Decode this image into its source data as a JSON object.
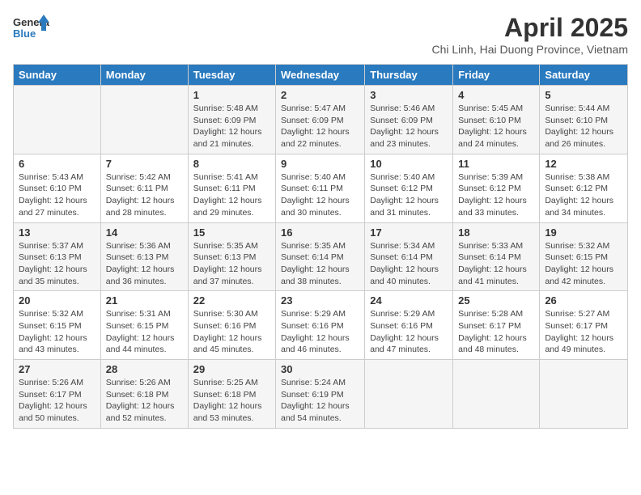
{
  "header": {
    "logo_general": "General",
    "logo_blue": "Blue",
    "title": "April 2025",
    "subtitle": "Chi Linh, Hai Duong Province, Vietnam"
  },
  "weekdays": [
    "Sunday",
    "Monday",
    "Tuesday",
    "Wednesday",
    "Thursday",
    "Friday",
    "Saturday"
  ],
  "weeks": [
    [
      {
        "day": "",
        "info": ""
      },
      {
        "day": "",
        "info": ""
      },
      {
        "day": "1",
        "info": "Sunrise: 5:48 AM\nSunset: 6:09 PM\nDaylight: 12 hours and 21 minutes."
      },
      {
        "day": "2",
        "info": "Sunrise: 5:47 AM\nSunset: 6:09 PM\nDaylight: 12 hours and 22 minutes."
      },
      {
        "day": "3",
        "info": "Sunrise: 5:46 AM\nSunset: 6:09 PM\nDaylight: 12 hours and 23 minutes."
      },
      {
        "day": "4",
        "info": "Sunrise: 5:45 AM\nSunset: 6:10 PM\nDaylight: 12 hours and 24 minutes."
      },
      {
        "day": "5",
        "info": "Sunrise: 5:44 AM\nSunset: 6:10 PM\nDaylight: 12 hours and 26 minutes."
      }
    ],
    [
      {
        "day": "6",
        "info": "Sunrise: 5:43 AM\nSunset: 6:10 PM\nDaylight: 12 hours and 27 minutes."
      },
      {
        "day": "7",
        "info": "Sunrise: 5:42 AM\nSunset: 6:11 PM\nDaylight: 12 hours and 28 minutes."
      },
      {
        "day": "8",
        "info": "Sunrise: 5:41 AM\nSunset: 6:11 PM\nDaylight: 12 hours and 29 minutes."
      },
      {
        "day": "9",
        "info": "Sunrise: 5:40 AM\nSunset: 6:11 PM\nDaylight: 12 hours and 30 minutes."
      },
      {
        "day": "10",
        "info": "Sunrise: 5:40 AM\nSunset: 6:12 PM\nDaylight: 12 hours and 31 minutes."
      },
      {
        "day": "11",
        "info": "Sunrise: 5:39 AM\nSunset: 6:12 PM\nDaylight: 12 hours and 33 minutes."
      },
      {
        "day": "12",
        "info": "Sunrise: 5:38 AM\nSunset: 6:12 PM\nDaylight: 12 hours and 34 minutes."
      }
    ],
    [
      {
        "day": "13",
        "info": "Sunrise: 5:37 AM\nSunset: 6:13 PM\nDaylight: 12 hours and 35 minutes."
      },
      {
        "day": "14",
        "info": "Sunrise: 5:36 AM\nSunset: 6:13 PM\nDaylight: 12 hours and 36 minutes."
      },
      {
        "day": "15",
        "info": "Sunrise: 5:35 AM\nSunset: 6:13 PM\nDaylight: 12 hours and 37 minutes."
      },
      {
        "day": "16",
        "info": "Sunrise: 5:35 AM\nSunset: 6:14 PM\nDaylight: 12 hours and 38 minutes."
      },
      {
        "day": "17",
        "info": "Sunrise: 5:34 AM\nSunset: 6:14 PM\nDaylight: 12 hours and 40 minutes."
      },
      {
        "day": "18",
        "info": "Sunrise: 5:33 AM\nSunset: 6:14 PM\nDaylight: 12 hours and 41 minutes."
      },
      {
        "day": "19",
        "info": "Sunrise: 5:32 AM\nSunset: 6:15 PM\nDaylight: 12 hours and 42 minutes."
      }
    ],
    [
      {
        "day": "20",
        "info": "Sunrise: 5:32 AM\nSunset: 6:15 PM\nDaylight: 12 hours and 43 minutes."
      },
      {
        "day": "21",
        "info": "Sunrise: 5:31 AM\nSunset: 6:15 PM\nDaylight: 12 hours and 44 minutes."
      },
      {
        "day": "22",
        "info": "Sunrise: 5:30 AM\nSunset: 6:16 PM\nDaylight: 12 hours and 45 minutes."
      },
      {
        "day": "23",
        "info": "Sunrise: 5:29 AM\nSunset: 6:16 PM\nDaylight: 12 hours and 46 minutes."
      },
      {
        "day": "24",
        "info": "Sunrise: 5:29 AM\nSunset: 6:16 PM\nDaylight: 12 hours and 47 minutes."
      },
      {
        "day": "25",
        "info": "Sunrise: 5:28 AM\nSunset: 6:17 PM\nDaylight: 12 hours and 48 minutes."
      },
      {
        "day": "26",
        "info": "Sunrise: 5:27 AM\nSunset: 6:17 PM\nDaylight: 12 hours and 49 minutes."
      }
    ],
    [
      {
        "day": "27",
        "info": "Sunrise: 5:26 AM\nSunset: 6:17 PM\nDaylight: 12 hours and 50 minutes."
      },
      {
        "day": "28",
        "info": "Sunrise: 5:26 AM\nSunset: 6:18 PM\nDaylight: 12 hours and 52 minutes."
      },
      {
        "day": "29",
        "info": "Sunrise: 5:25 AM\nSunset: 6:18 PM\nDaylight: 12 hours and 53 minutes."
      },
      {
        "day": "30",
        "info": "Sunrise: 5:24 AM\nSunset: 6:19 PM\nDaylight: 12 hours and 54 minutes."
      },
      {
        "day": "",
        "info": ""
      },
      {
        "day": "",
        "info": ""
      },
      {
        "day": "",
        "info": ""
      }
    ]
  ]
}
